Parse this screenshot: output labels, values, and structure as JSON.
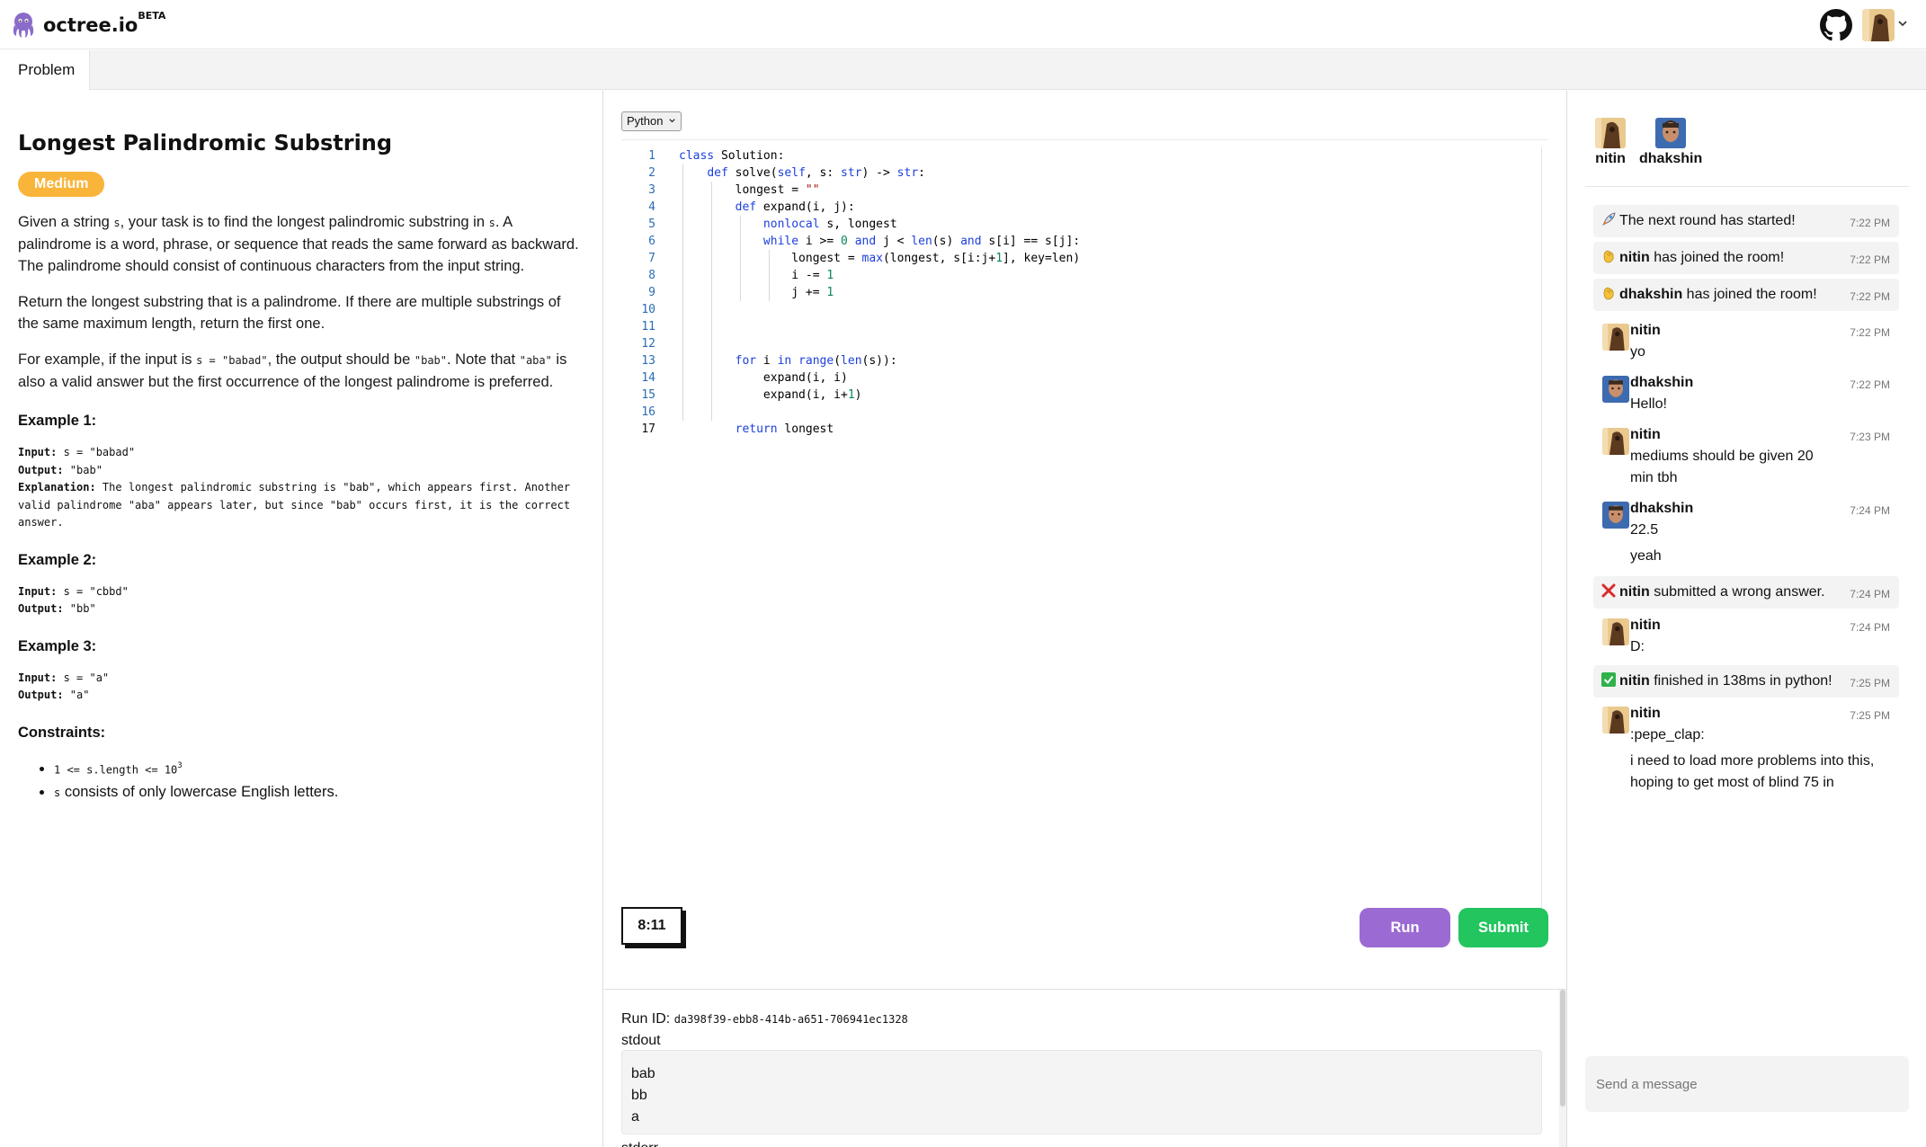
{
  "app": {
    "name": "octree.io",
    "tag": "BETA"
  },
  "tabs": [
    {
      "label": "Problem"
    }
  ],
  "problem": {
    "title": "Longest Palindromic Substring",
    "difficulty": "Medium",
    "p1": {
      "a": "Given a string ",
      "code": "s",
      "b": ", your task is to find the longest palindromic substring in ",
      "code2": "s",
      "c": ". A palindrome is a word, phrase, or sequence that reads the same forward as backward. The palindrome should consist of continuous characters from the input string."
    },
    "p2": "Return the longest substring that is a palindrome. If there are multiple substrings of the same maximum length, return the first one.",
    "p3": {
      "a": "For example, if the input is ",
      "code1": "s = \"babad\"",
      "b": ", the output should be ",
      "code2": "\"bab\"",
      "c": ". Note that ",
      "code3": "\"aba\"",
      "d": " is also a valid answer but the first occurrence of the longest palindrome is preferred."
    },
    "examples": [
      {
        "heading": "Example 1:",
        "input_label": "Input:",
        "input": " s = \"babad\"",
        "output_label": "Output:",
        "output": " \"bab\"",
        "expl_label": "Explanation:",
        "expl": " The longest palindromic substring is \"bab\", which appears first. Another valid palindrome \"aba\" appears later, but since \"bab\" occurs first, it is the correct answer."
      },
      {
        "heading": "Example 2:",
        "input_label": "Input:",
        "input": " s = \"cbbd\"",
        "output_label": "Output:",
        "output": " \"bb\""
      },
      {
        "heading": "Example 3:",
        "input_label": "Input:",
        "input": " s = \"a\"",
        "output_label": "Output:",
        "output": " \"a\""
      }
    ],
    "constraints_heading": "Constraints:",
    "constraints": [
      {
        "code": "1 <= s.length <= 10",
        "sup": "3"
      },
      {
        "code": "s",
        "text": " consists of only lowercase English letters."
      }
    ]
  },
  "editor": {
    "language": "Python",
    "line_numbers": [
      "1",
      "2",
      "3",
      "4",
      "5",
      "6",
      "7",
      "8",
      "9",
      "10",
      "11",
      "12",
      "13",
      "14",
      "15",
      "16",
      "17"
    ],
    "timer": "8:11",
    "run_label": "Run",
    "submit_label": "Submit"
  },
  "output": {
    "run_id_label": "Run ID: ",
    "run_id": "da398f39-ebb8-414b-a651-706941ec1328",
    "stdout_label": "stdout",
    "stdout_lines": [
      "bab",
      "bb",
      "a"
    ],
    "stderr_label": "stderr"
  },
  "chat": {
    "users": [
      {
        "name": "nitin"
      },
      {
        "name": "dhakshin"
      }
    ],
    "system": [
      {
        "text": "The next round has started!",
        "time": "7:22 PM"
      },
      {
        "name": "nitin",
        "text": " has joined the room!",
        "time": "7:22 PM"
      },
      {
        "name": "dhakshin",
        "text": " has joined the room!",
        "time": "7:22 PM"
      },
      {
        "name": "nitin",
        "text": " submitted a wrong answer.",
        "time": "7:24 PM"
      },
      {
        "name": "nitin",
        "text": " finished in 138ms in python!",
        "time": "7:25 PM"
      }
    ],
    "messages": [
      {
        "name": "nitin",
        "time": "7:22 PM",
        "lines": [
          "yo"
        ]
      },
      {
        "name": "dhakshin",
        "time": "7:22 PM",
        "lines": [
          "Hello!"
        ]
      },
      {
        "name": "nitin",
        "time": "7:23 PM",
        "lines": [
          "mediums should be given 20 min tbh"
        ]
      },
      {
        "name": "dhakshin",
        "time": "7:24 PM",
        "lines": [
          "22.5",
          "yeah"
        ]
      },
      {
        "name": "nitin",
        "time": "7:24 PM",
        "lines": [
          "D:"
        ]
      },
      {
        "name": "nitin",
        "time": "7:25 PM",
        "lines": [
          ":pepe_clap:",
          "i need to load more problems into this, hoping to get most of blind 75 in"
        ]
      }
    ],
    "send_placeholder": "Send a message"
  },
  "colors": {
    "accent_run": "#9b6bd3",
    "accent_submit": "#22c55e",
    "badge_medium": "#f9b43a"
  },
  "icons": [
    "octopus-logo-icon",
    "github-icon",
    "chevron-down-icon",
    "rocket-icon",
    "wave-hand-icon",
    "cross-mark-icon",
    "check-mark-icon"
  ]
}
